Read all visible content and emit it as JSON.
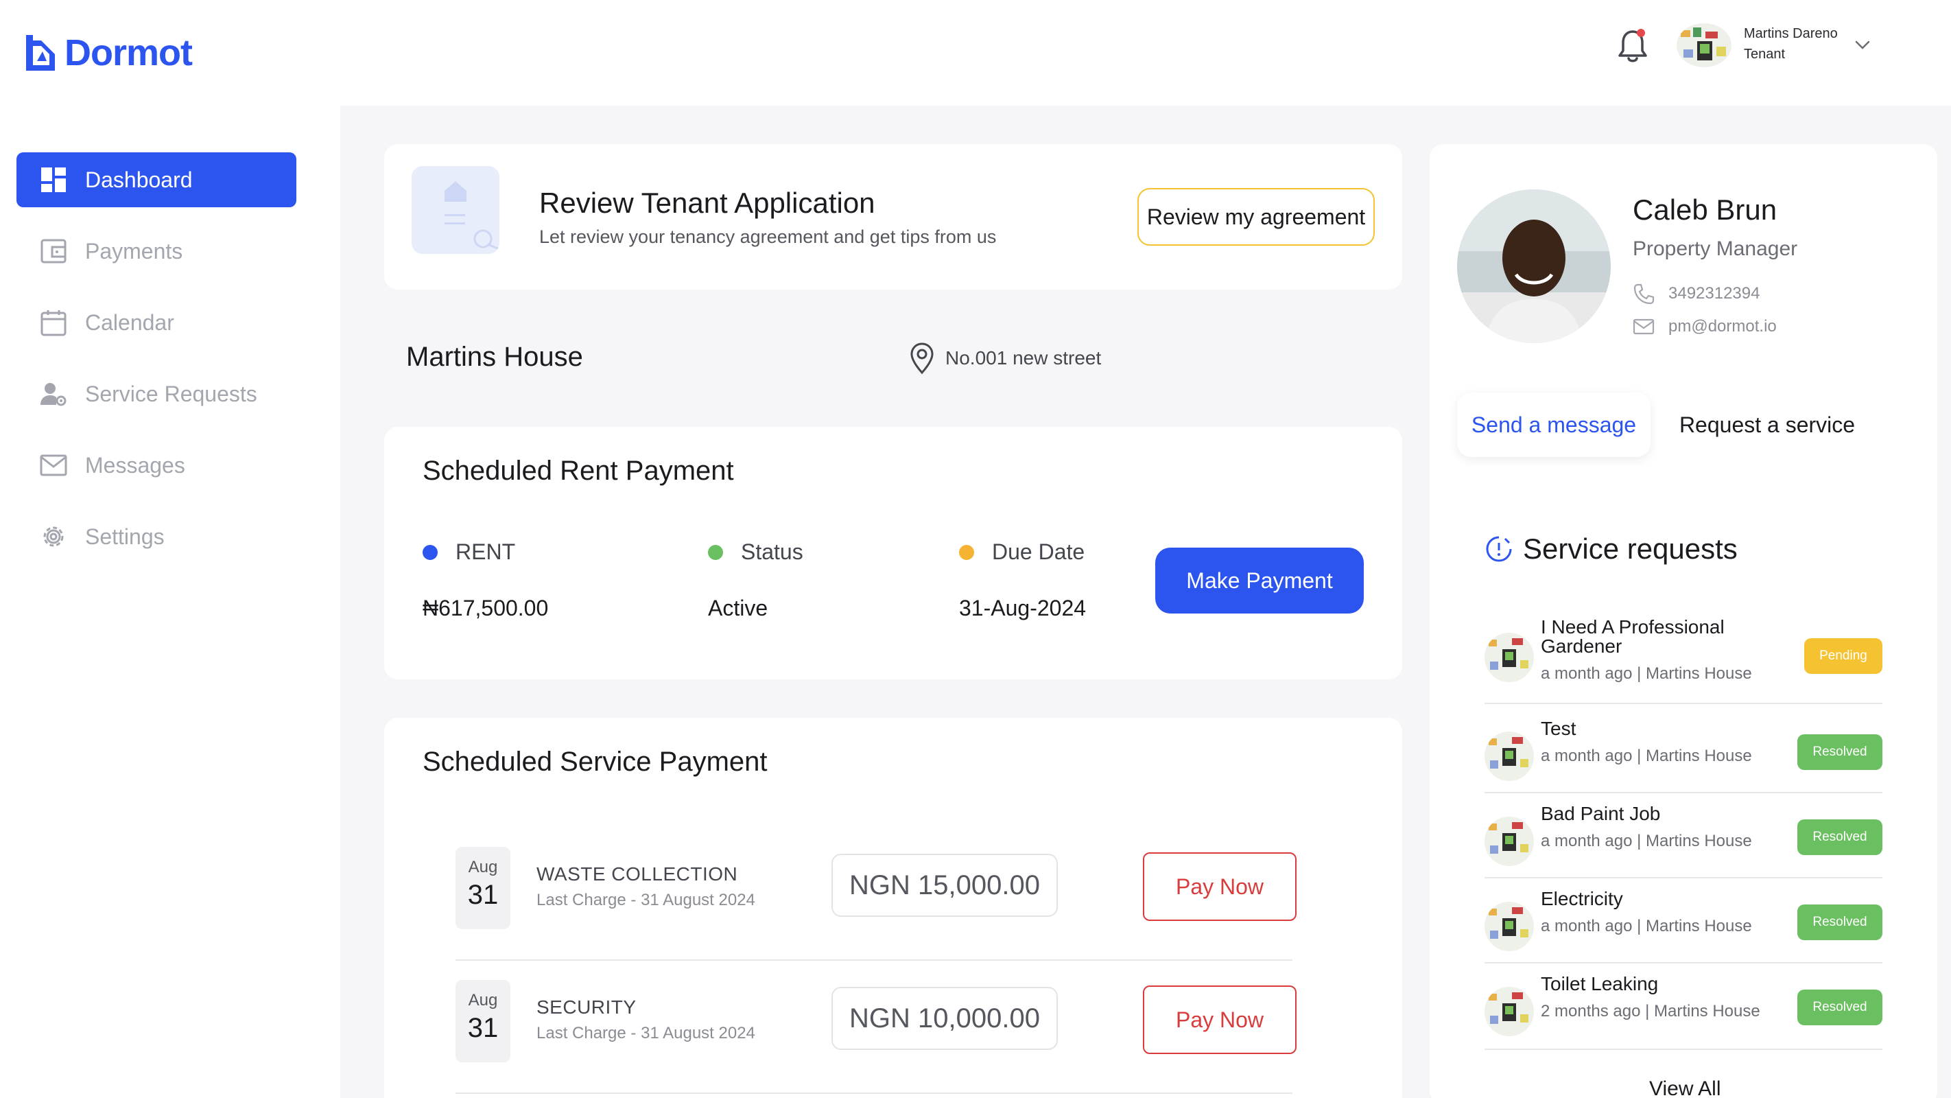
{
  "brand": {
    "name": "Dormot",
    "accent": "#2c55f0"
  },
  "user": {
    "name": "Martins Dareno",
    "role": "Tenant"
  },
  "sidebar": {
    "items": [
      {
        "label": "Dashboard",
        "icon": "dashboard-icon",
        "active": true
      },
      {
        "label": "Payments",
        "icon": "wallet-icon"
      },
      {
        "label": "Calendar",
        "icon": "calendar-icon"
      },
      {
        "label": "Service Requests",
        "icon": "user-gear-icon"
      },
      {
        "label": "Messages",
        "icon": "envelope-icon"
      },
      {
        "label": "Settings",
        "icon": "gear-icon"
      }
    ]
  },
  "review": {
    "title": "Review Tenant Application",
    "subtitle": "Let review your tenancy agreement and get tips from us",
    "button": "Review my agreement"
  },
  "house": {
    "name": "Martins House",
    "address": "No.001 new street"
  },
  "rent": {
    "title": "Scheduled Rent Payment",
    "columns": [
      {
        "label": "RENT",
        "value": "₦617,500.00",
        "color": "#2c55f0"
      },
      {
        "label": "Status",
        "value": "Active",
        "color": "#6abf61"
      },
      {
        "label": "Due Date",
        "value": "31-Aug-2024",
        "color": "#f5b331"
      }
    ],
    "button": "Make Payment"
  },
  "service_payment": {
    "title": "Scheduled Service Payment",
    "rows": [
      {
        "month": "Aug",
        "day": "31",
        "name": "WASTE COLLECTION",
        "last_charge": "Last Charge - 31 August 2024",
        "amount": "NGN 15,000.00",
        "button": "Pay Now"
      },
      {
        "month": "Aug",
        "day": "31",
        "name": "SECURITY",
        "last_charge": "Last Charge - 31 August 2024",
        "amount": "NGN 10,000.00",
        "button": "Pay Now"
      }
    ]
  },
  "manager": {
    "first_name": "Caleb",
    "last_name": "Brun",
    "role": "Property Manager",
    "phone": "3492312394",
    "email": "pm@dormot.io",
    "send_message": "Send a message",
    "request_service": "Request a service"
  },
  "service_requests": {
    "title": "Service requests",
    "items": [
      {
        "title": "I Need A Professional Gardener",
        "meta": "a month ago | Martins House",
        "status": "Pending"
      },
      {
        "title": "Test",
        "meta": "a month ago | Martins House",
        "status": "Resolved"
      },
      {
        "title": "Bad Paint Job",
        "meta": "a month ago | Martins House",
        "status": "Resolved"
      },
      {
        "title": "Electricity",
        "meta": "a month ago | Martins House",
        "status": "Resolved"
      },
      {
        "title": "Toilet Leaking",
        "meta": "2 months ago | Martins House",
        "status": "Resolved"
      }
    ],
    "view_all": "View All"
  }
}
